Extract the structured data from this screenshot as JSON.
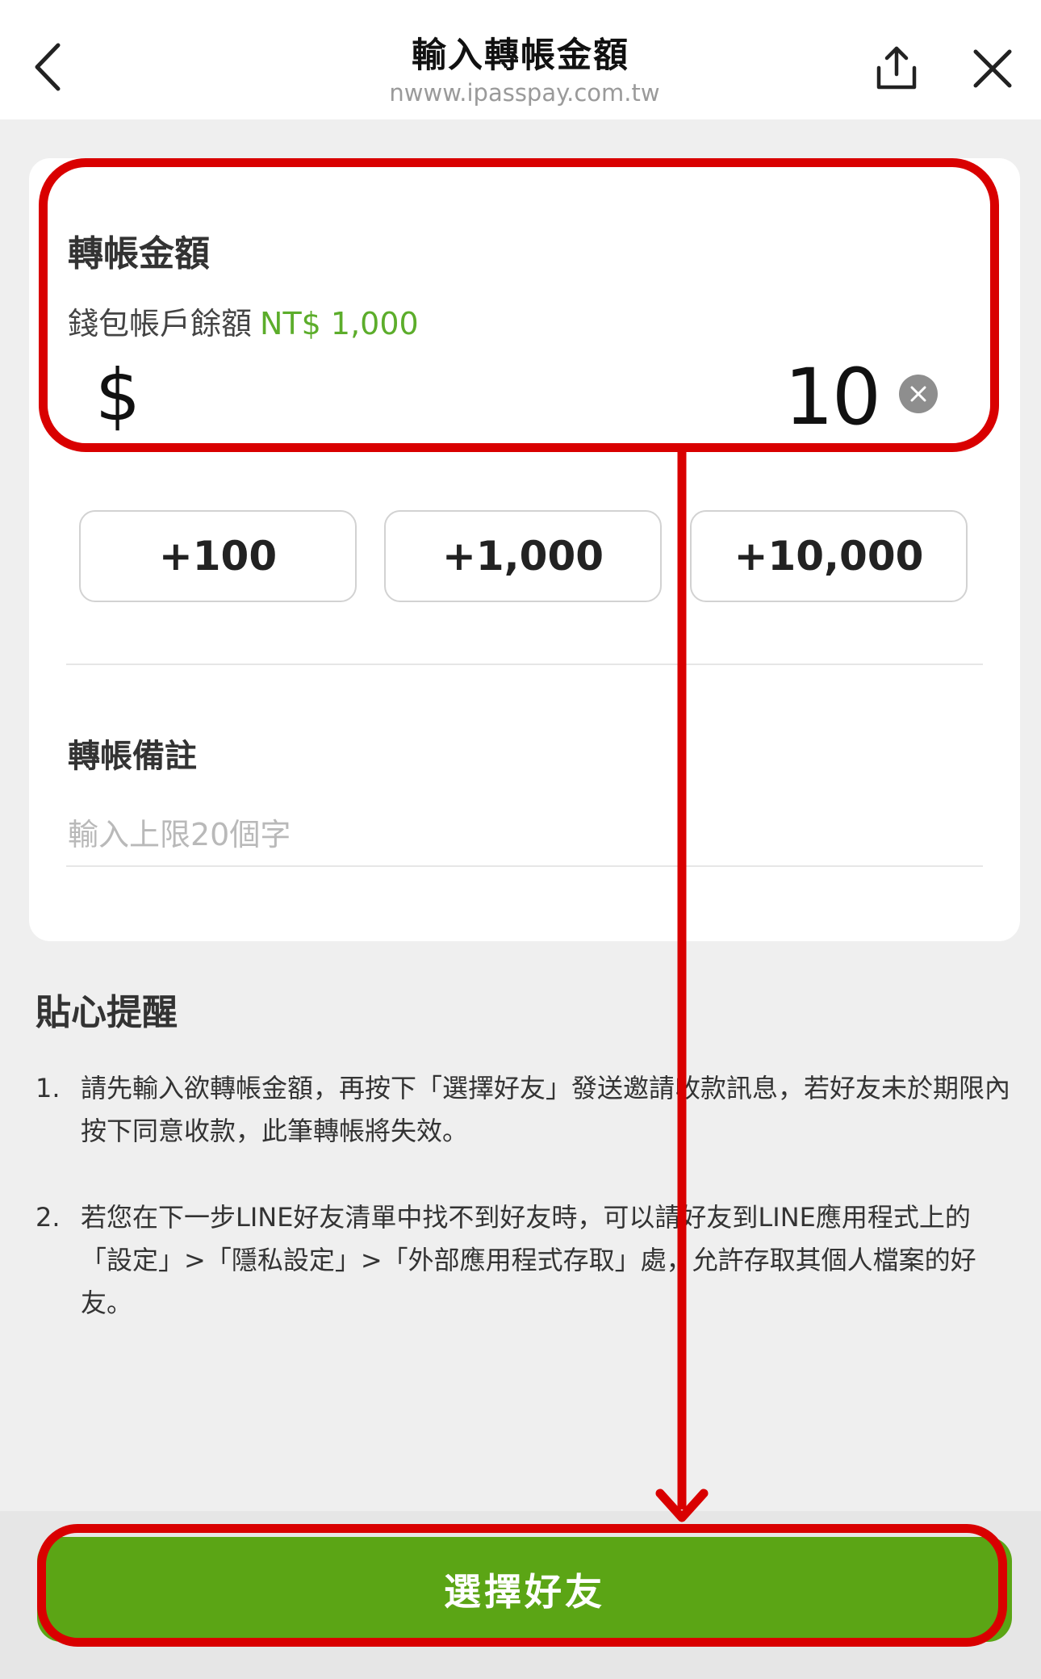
{
  "header": {
    "title": "輸入轉帳金額",
    "url": "nwww.ipasspay.com.tw",
    "icons": [
      "back-chevron-icon",
      "share-icon",
      "close-icon"
    ]
  },
  "amount_section": {
    "label": "轉帳金額",
    "balance_label": "錢包帳戶餘額",
    "balance_value": "NT$ 1,000",
    "currency_symbol": "$",
    "amount_value": "10"
  },
  "quick_amounts": [
    "+100",
    "+1,000",
    "+10,000"
  ],
  "note_section": {
    "label": "轉帳備註",
    "placeholder": "輸入上限20個字"
  },
  "reminder": {
    "title": "貼心提醒",
    "items": [
      {
        "num": "1.",
        "text": "請先輸入欲轉帳金額，再按下「選擇好友」發送邀請收款訊息，若好友未於期限內按下同意收款，此筆轉帳將失效。"
      },
      {
        "num": "2.",
        "text": "若您在下一步LINE好友清單中找不到好友時，可以請好友到LINE應用程式上的「設定」>「隱私設定」>「外部應用程式存取」處，允許存取其個人檔案的好友。"
      }
    ]
  },
  "cta": {
    "label": "選擇好友"
  },
  "colors": {
    "accent_green": "#5ba515",
    "balance_green": "#5cad2b",
    "annotation_red": "#d90000"
  }
}
